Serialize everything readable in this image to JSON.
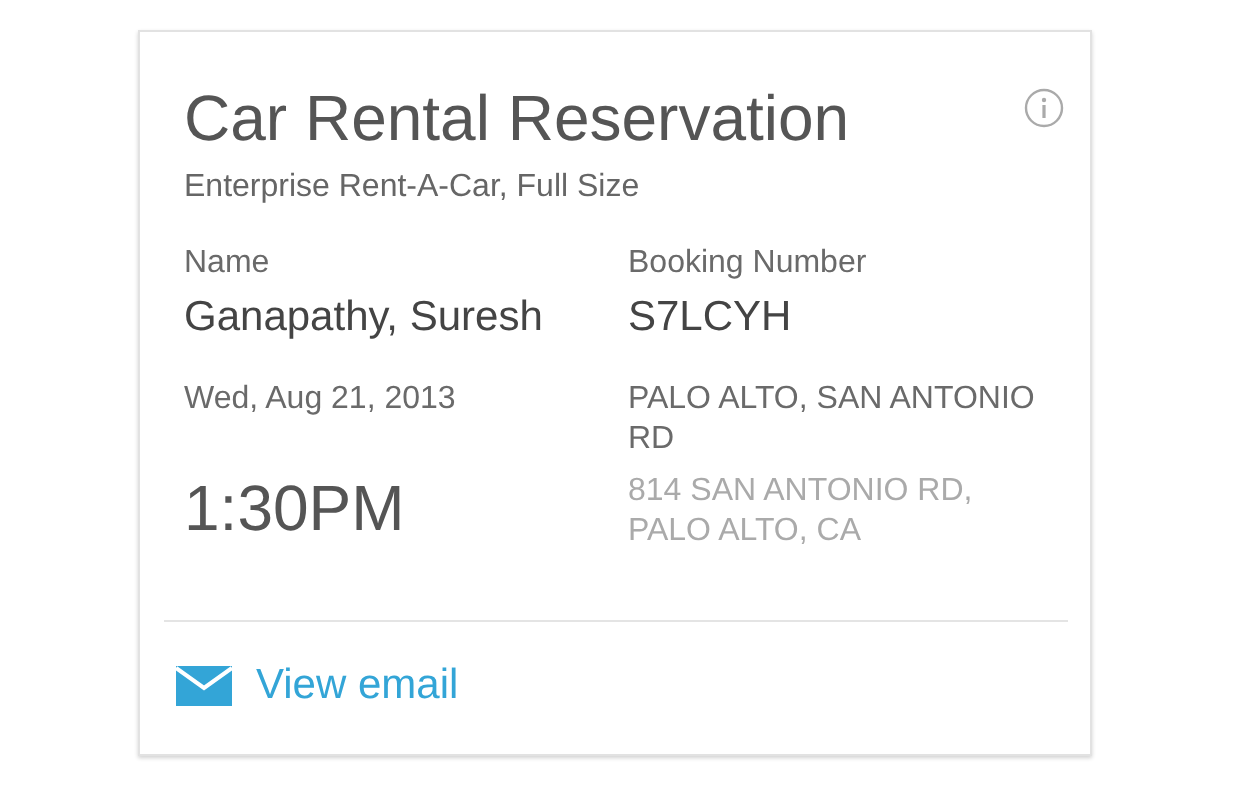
{
  "card": {
    "title": "Car Rental Reservation",
    "subtitle": "Enterprise Rent-A-Car, Full Size",
    "fields": [
      {
        "label": "Name",
        "value": "Ganapathy, Suresh"
      },
      {
        "label": "Booking Number",
        "value": "S7LCYH"
      }
    ],
    "pickup": {
      "date": "Wed, Aug 21, 2013",
      "time": "1:30PM",
      "location": "PALO ALTO, SAN ANTONIO RD",
      "address": "814 SAN ANTONIO RD, PALO ALTO, CA"
    },
    "action": {
      "label": "View email"
    }
  }
}
